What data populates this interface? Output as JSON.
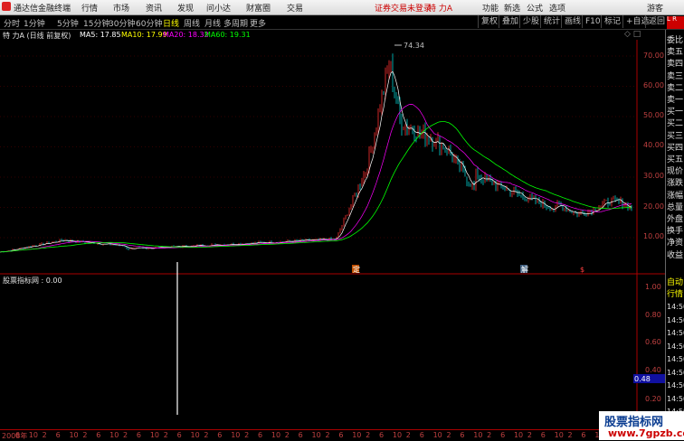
{
  "menu": {
    "app_name": "通达信金融终端",
    "items": [
      "行情",
      "市场",
      "资讯",
      "发现",
      "问小达",
      "财富圈",
      "交易"
    ],
    "status": "证券交易未登录",
    "stock": "特 力A",
    "right": [
      "功能",
      "新选",
      "公式",
      "选项",
      "游客"
    ]
  },
  "periods": [
    "分时",
    "1分钟",
    "5分钟",
    "15分钟",
    "30分钟",
    "60分钟",
    "日线",
    "周线",
    "月线",
    "多周期",
    "更多"
  ],
  "active_period": "日线",
  "toolbar": [
    "复权",
    "叠加",
    "少股",
    "统计",
    "画线",
    "F10",
    "标记",
    "+自选",
    "返回"
  ],
  "ma_bar": {
    "title": "特 力A (日线 前复权)",
    "ma5": "MA5: 17.85",
    "ma10": "MA10: 17.99",
    "ma20": "MA20: 18.32",
    "ma60": "MA60: 19.31",
    "colors": {
      "ma5": "#ffffff",
      "ma10": "#ffff00",
      "ma20": "#ff00ff",
      "ma60": "#00ff00"
    }
  },
  "indicator": {
    "title": "股票指标网 : 0.00"
  },
  "peak_label": "74.34",
  "markers": [
    "定",
    "解",
    "$"
  ],
  "right_panel": {
    "labels": [
      "委比",
      "卖五",
      "卖四",
      "卖三",
      "卖二",
      "卖一",
      "买一",
      "买二",
      "买三",
      "买四",
      "买五",
      "现价",
      "涨跌",
      "涨幅",
      "总量",
      "外盘",
      "换手",
      "净资",
      "收益"
    ],
    "lower_labels": [
      "自动",
      "行情"
    ],
    "times": [
      "14:50",
      "14:50",
      "14:50",
      "14:50",
      "14:50",
      "14:50",
      "14:50",
      "14:50",
      "14:50",
      "14:50"
    ]
  },
  "y_axis_price": [
    "70.00",
    "60.00",
    "50.00",
    "40.00",
    "30.00",
    "20.00",
    "10.00"
  ],
  "y_axis_ind": [
    "1.00",
    "0.80",
    "0.60",
    "0.48",
    "0.40",
    "0.20"
  ],
  "x_axis": [
    "2008年",
    "6",
    "10",
    "2",
    "6",
    "10",
    "2",
    "6",
    "10",
    "2",
    "6",
    "10",
    "2",
    "6",
    "10",
    "2",
    "6",
    "10",
    "2",
    "6",
    "10",
    "2",
    "6",
    "10",
    "2",
    "6",
    "10",
    "2",
    "6",
    "10",
    "2",
    "6",
    "10",
    "2",
    "6",
    "10",
    "2",
    "6",
    "10",
    "2",
    "6",
    "10",
    "2",
    "6",
    "10",
    "2",
    "6"
  ],
  "watermark": {
    "line1": "股票指标网",
    "line2": "www.7gpzb.com"
  }
}
